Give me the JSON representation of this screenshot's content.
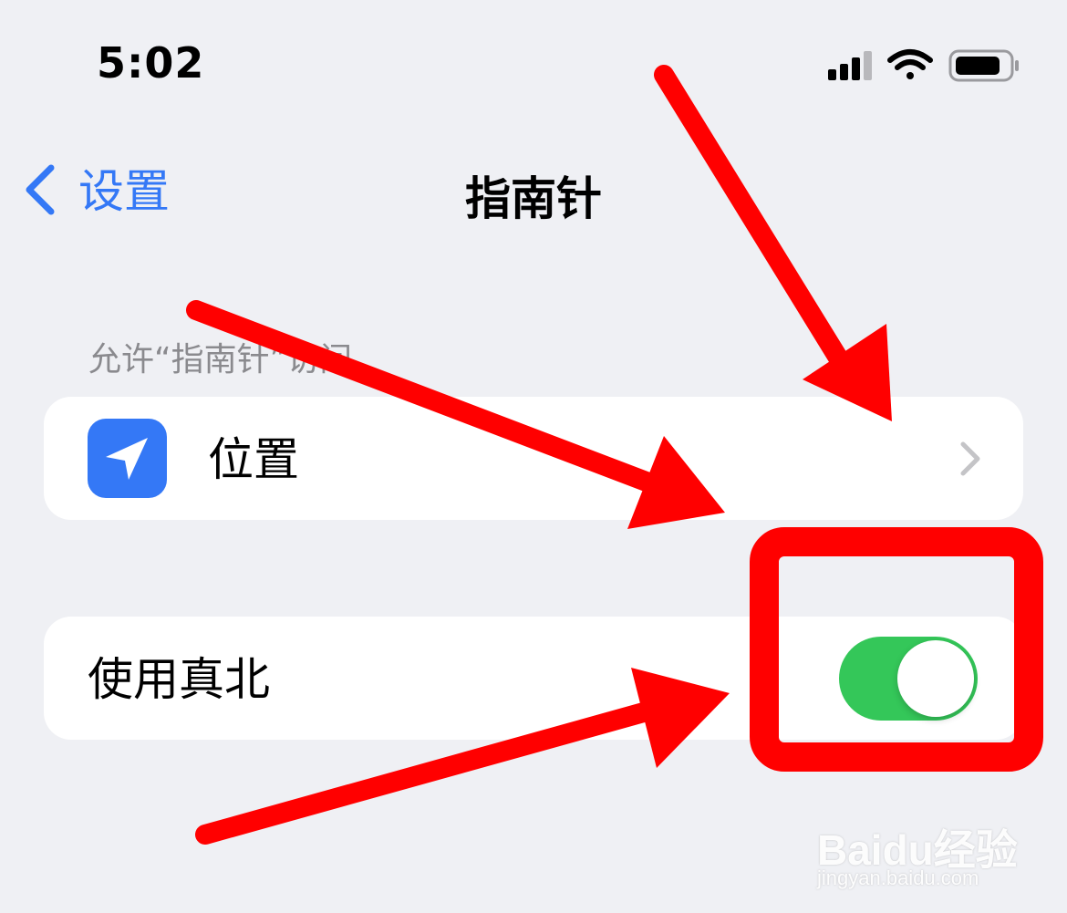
{
  "status_bar": {
    "time": "5:02",
    "icons": [
      "cellular-signal-icon",
      "wifi-icon",
      "battery-icon"
    ]
  },
  "nav": {
    "back_label": "设置",
    "title": "指南针"
  },
  "section": {
    "header": "允许“指南针”访问"
  },
  "rows": {
    "location_label": "位置",
    "true_north_label": "使用真北",
    "true_north_enabled": true
  },
  "watermark": {
    "brand": "Baidu经验",
    "url": "jingyan.baidu.com"
  },
  "colors": {
    "accent_blue": "#3478f6",
    "toggle_on": "#34c759",
    "annotation_red": "#ff0000",
    "background": "#eff0f4"
  }
}
